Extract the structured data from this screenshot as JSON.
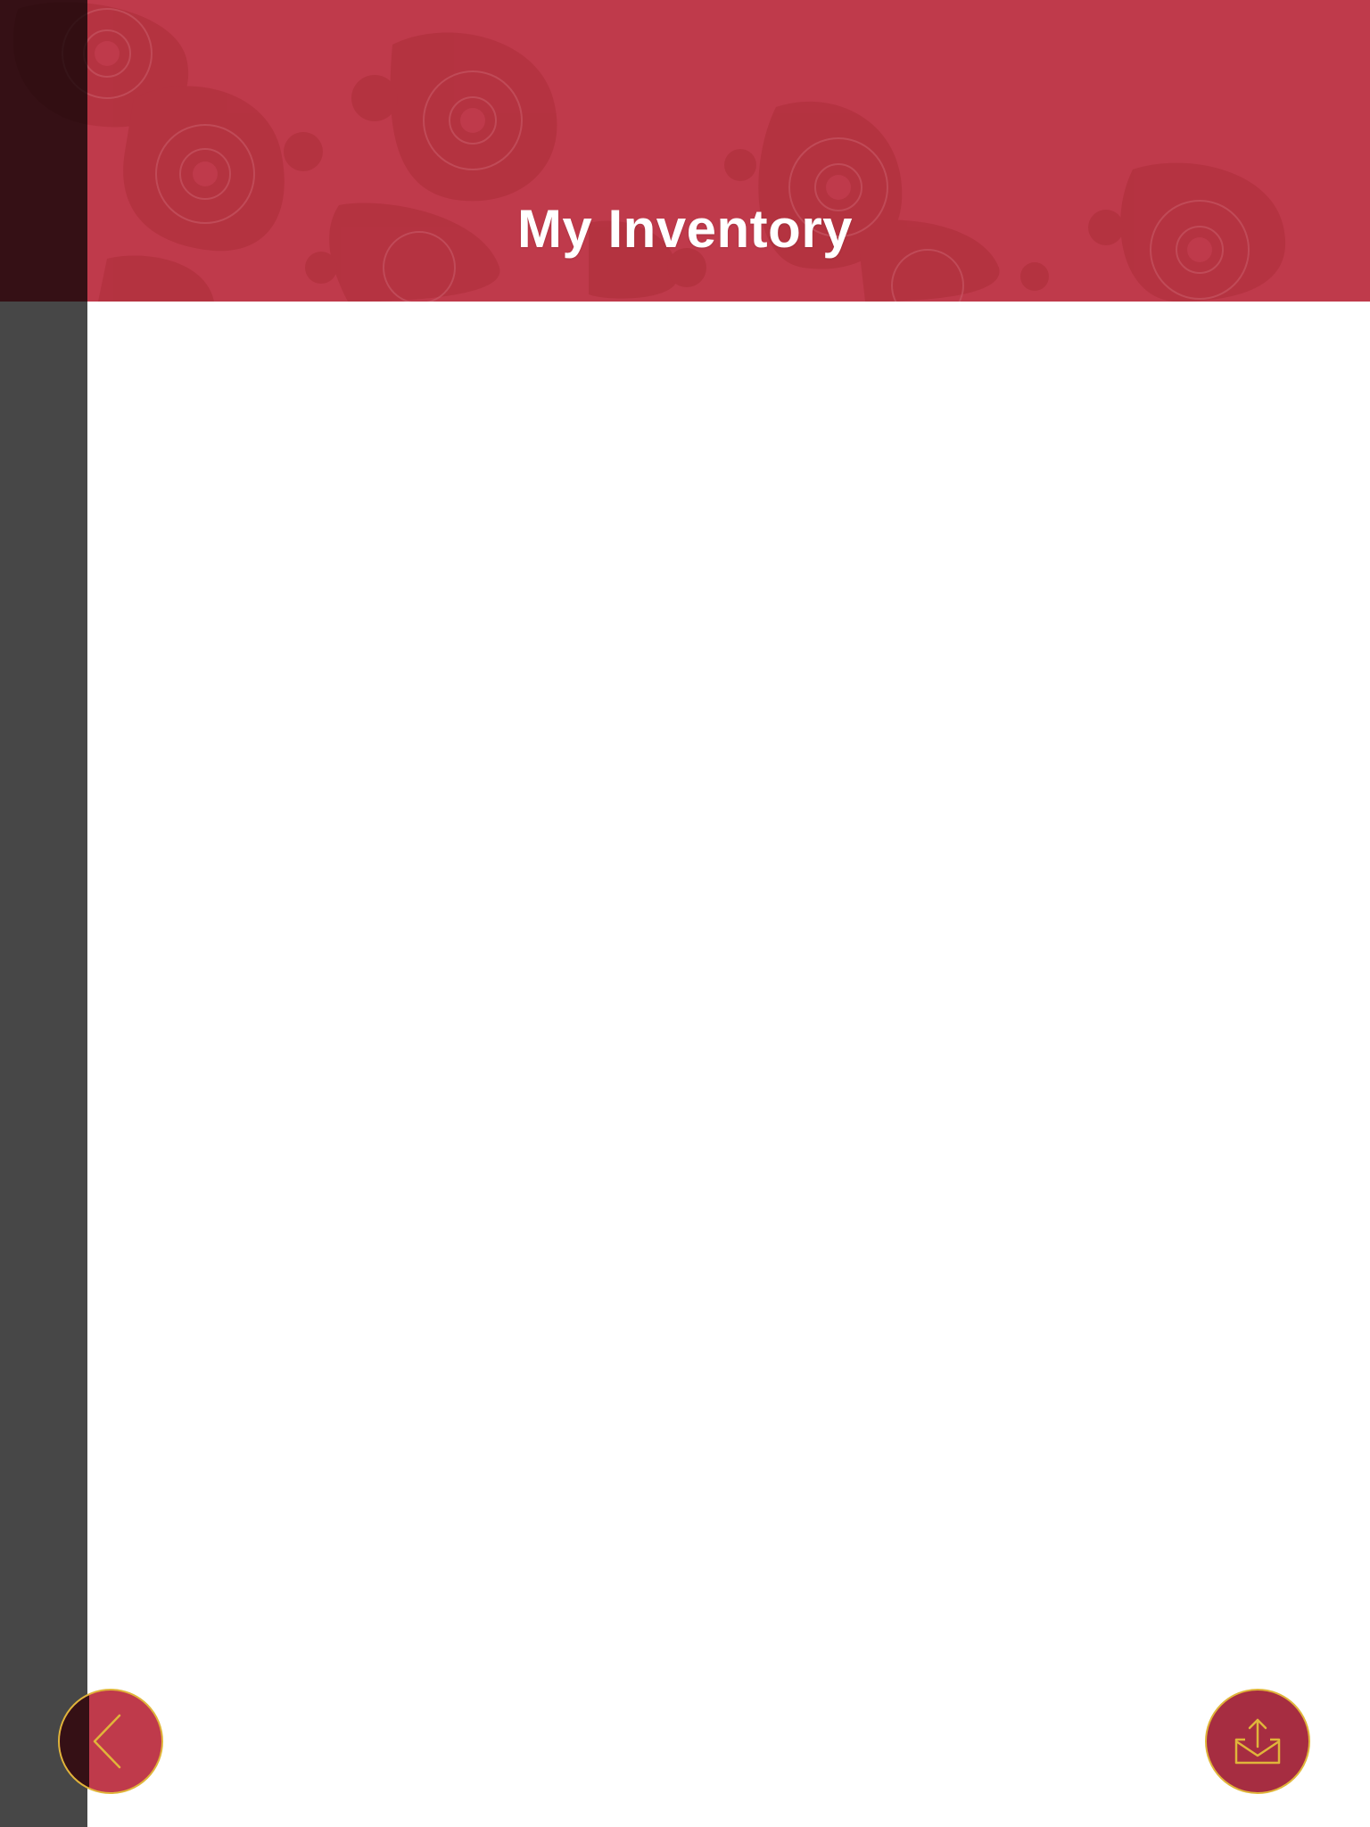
{
  "header": {
    "title": "My Inventory"
  },
  "buttons": {
    "back_icon": "chevron-left-icon",
    "share_icon": "share-mail-icon"
  },
  "colors": {
    "brand_red": "#bf3a4b",
    "button_red": "#a62d41",
    "accent_gold": "#e0b53a",
    "overlay": "#3a3a3a"
  }
}
